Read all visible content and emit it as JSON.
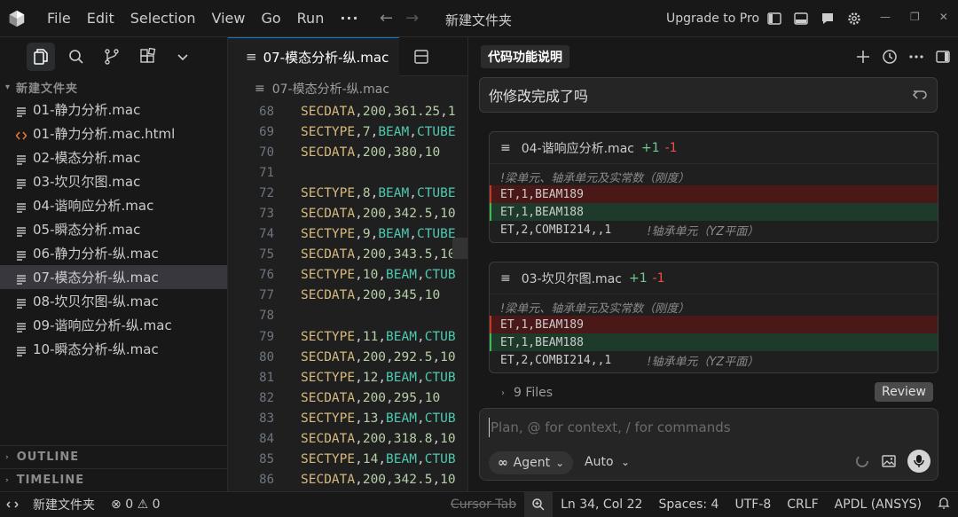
{
  "titlebar": {
    "menu": [
      "File",
      "Edit",
      "Selection",
      "View",
      "Go",
      "Run"
    ],
    "more": "···",
    "back_arrow": "←",
    "forward_arrow": "→",
    "title": "新建文件夹",
    "upgrade": "Upgrade to Pro",
    "minimize": "—",
    "restore": "❐",
    "close": "✕"
  },
  "sidebar": {
    "folder_name": "新建文件夹",
    "files": [
      {
        "name": "01-静力分析.mac",
        "icon": "list-icon"
      },
      {
        "name": "01-静力分析.mac.html",
        "icon": "html-icon"
      },
      {
        "name": "02-模态分析.mac",
        "icon": "list-icon"
      },
      {
        "name": "03-坎贝尔图.mac",
        "icon": "list-icon"
      },
      {
        "name": "04-谐响应分析.mac",
        "icon": "list-icon"
      },
      {
        "name": "05-瞬态分析.mac",
        "icon": "list-icon"
      },
      {
        "name": "06-静力分析-纵.mac",
        "icon": "list-icon"
      },
      {
        "name": "07-模态分析-纵.mac",
        "icon": "list-icon"
      },
      {
        "name": "08-坎贝尔图-纵.mac",
        "icon": "list-icon"
      },
      {
        "name": "09-谐响应分析-纵.mac",
        "icon": "list-icon"
      },
      {
        "name": "10-瞬态分析-纵.mac",
        "icon": "list-icon"
      }
    ],
    "active_index": 7,
    "outline": "OUTLINE",
    "timeline": "TIMELINE"
  },
  "editor": {
    "tab": "07-模态分析-纵.mac",
    "breadcrumb": "07-模态分析-纵.mac",
    "lines": [
      {
        "n": "68",
        "text": "SECDATA,200,361.25,1"
      },
      {
        "n": "69",
        "text": "SECTYPE,7,BEAM,CTUBE"
      },
      {
        "n": "70",
        "text": "SECDATA,200,380,10"
      },
      {
        "n": "71",
        "text": ""
      },
      {
        "n": "72",
        "text": "SECTYPE,8,BEAM,CTUBE"
      },
      {
        "n": "73",
        "text": "SECDATA,200,342.5,10"
      },
      {
        "n": "74",
        "text": "SECTYPE,9,BEAM,CTUBE"
      },
      {
        "n": "75",
        "text": "SECDATA,200,343.5,10"
      },
      {
        "n": "76",
        "text": "SECTYPE,10,BEAM,CTUB"
      },
      {
        "n": "77",
        "text": "SECDATA,200,345,10"
      },
      {
        "n": "78",
        "text": ""
      },
      {
        "n": "79",
        "text": "SECTYPE,11,BEAM,CTUB"
      },
      {
        "n": "80",
        "text": "SECDATA,200,292.5,10"
      },
      {
        "n": "81",
        "text": "SECTYPE,12,BEAM,CTUB"
      },
      {
        "n": "82",
        "text": "SECDATA,200,295,10"
      },
      {
        "n": "83",
        "text": "SECTYPE,13,BEAM,CTUB"
      },
      {
        "n": "84",
        "text": "SECDATA,200,318.8,10"
      },
      {
        "n": "85",
        "text": "SECTYPE,14,BEAM,CTUB"
      },
      {
        "n": "86",
        "text": "SECDATA,200,342.5,10"
      }
    ]
  },
  "chat": {
    "title": "代码功能说明",
    "user_message": "你修改完成了吗",
    "diffs": [
      {
        "file": "04-谐响应分析.mac",
        "added": "+1",
        "removed": "-1",
        "comment": "!梁单元、轴承单元及实常数（刚度）",
        "removed_line": "ET,1,BEAM189",
        "added_line": "ET,1,BEAM188",
        "context_code": "ET,2,COMBI214,,1",
        "context_comment": "!轴承单元（YZ平面）"
      },
      {
        "file": "03-坎贝尔图.mac",
        "added": "+1",
        "removed": "-1",
        "comment": "!梁单元、轴承单元及实常数（刚度）",
        "removed_line": "ET,1,BEAM189",
        "added_line": "ET,1,BEAM188",
        "context_code": "ET,2,COMBI214,,1",
        "context_comment": "!轴承单元（YZ平面）"
      }
    ],
    "files_count": "9 Files",
    "review": "Review",
    "composer_placeholder": "Plan, @ for context, / for commands",
    "agent": "Agent",
    "agent_chevron": "⌄",
    "model": "Auto",
    "model_chevron": "⌄"
  },
  "statusbar": {
    "folder": "新建文件夹",
    "errors": "0",
    "warnings": "0",
    "cursor_tab": "Cursor Tab",
    "position": "Ln 34, Col 22",
    "spaces": "Spaces: 4",
    "encoding": "UTF-8",
    "eol": "CRLF",
    "language": "APDL (ANSYS)"
  }
}
